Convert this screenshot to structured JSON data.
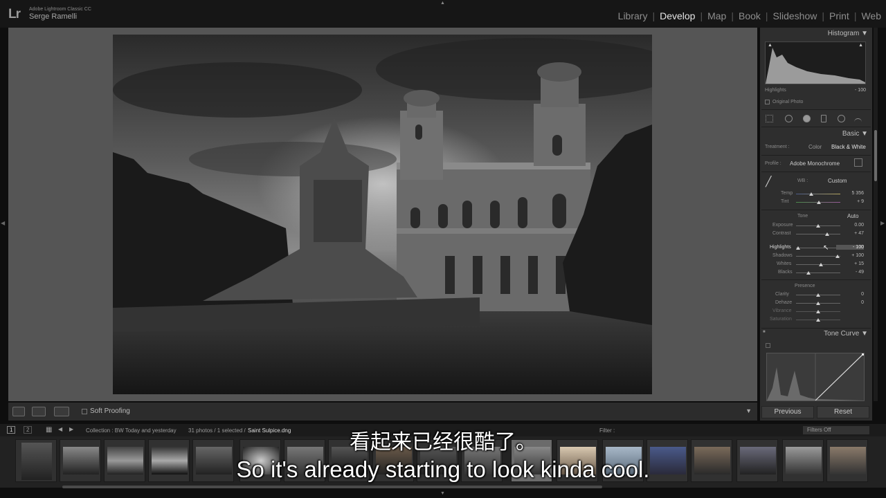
{
  "app": {
    "logo": "Lr",
    "product": "Adobe Lightroom Classic CC",
    "user": "Serge Ramelli"
  },
  "modules": [
    {
      "label": "Library",
      "active": false
    },
    {
      "label": "Develop",
      "active": true
    },
    {
      "label": "Map",
      "active": false
    },
    {
      "label": "Book",
      "active": false
    },
    {
      "label": "Slideshow",
      "active": false
    },
    {
      "label": "Print",
      "active": false
    },
    {
      "label": "Web",
      "active": false
    }
  ],
  "toolbar": {
    "soft_proofing": "Soft Proofing"
  },
  "histogram": {
    "title": "Histogram",
    "readout_label": "Highlights",
    "readout_value": "- 100",
    "original_photo": "Original Photo"
  },
  "basic": {
    "title": "Basic",
    "treatment_label": "Treatment :",
    "treatment_color": "Color",
    "treatment_bw": "Black & White",
    "profile_label": "Profile :",
    "profile_value": "Adobe Monochrome",
    "wb_label": "WB :",
    "wb_value": "Custom",
    "temp": {
      "label": "Temp",
      "value": "5 356",
      "pos": 0.35
    },
    "tint": {
      "label": "Tint",
      "value": "+ 9",
      "pos": 0.52
    },
    "tone_label": "Tone",
    "auto_label": "Auto",
    "exposure": {
      "label": "Exposure",
      "value": "0.00",
      "pos": 0.5
    },
    "contrast": {
      "label": "Contrast",
      "value": "+ 47",
      "pos": 0.7
    },
    "highlights": {
      "label": "Highlights",
      "value": "- 100",
      "pos": 0.05
    },
    "shadows": {
      "label": "Shadows",
      "value": "+ 100",
      "pos": 0.93
    },
    "whites": {
      "label": "Whites",
      "value": "+ 15",
      "pos": 0.57
    },
    "blacks": {
      "label": "Blacks",
      "value": "- 49",
      "pos": 0.28
    },
    "presence_label": "Presence",
    "clarity": {
      "label": "Clarity",
      "value": "0",
      "pos": 0.5
    },
    "dehaze": {
      "label": "Dehaze",
      "value": "0",
      "pos": 0.5
    },
    "vibrance": {
      "label": "Vibrance",
      "value": "",
      "pos": 0.5
    },
    "saturation": {
      "label": "Saturation",
      "value": "",
      "pos": 0.5
    }
  },
  "tone_curve": {
    "title": "Tone Curve"
  },
  "buttons": {
    "previous": "Previous",
    "reset": "Reset"
  },
  "filmstrip": {
    "page1": "1",
    "page2": "2",
    "collection": "Collection : BW Today and yesterday",
    "count": "31 photos / 1 selected /",
    "filename": "Saint Sulpice.dng",
    "filter_label": "Filter :",
    "filters_off": "Filters Off"
  },
  "subtitles": {
    "chinese": "看起来已经很酷了。",
    "english": "So it's already starting to look kinda cool."
  }
}
